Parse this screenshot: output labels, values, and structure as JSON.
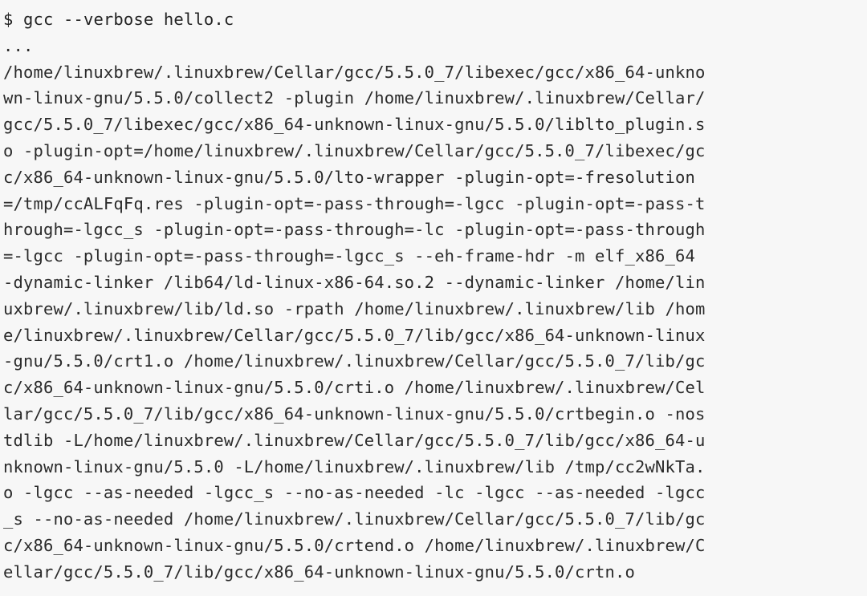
{
  "terminal": {
    "prompt": "$",
    "command": "gcc --verbose hello.c",
    "ellipsis": "...",
    "output": [
      "/home/linuxbrew/.linuxbrew/Cellar/gcc/5.5.0_7/libexec/gcc/x86_64-unkno",
      "wn-linux-gnu/5.5.0/collect2 -plugin /home/linuxbrew/.linuxbrew/Cellar/",
      "gcc/5.5.0_7/libexec/gcc/x86_64-unknown-linux-gnu/5.5.0/liblto_plugin.s",
      "o -plugin-opt=/home/linuxbrew/.linuxbrew/Cellar/gcc/5.5.0_7/libexec/gc",
      "c/x86_64-unknown-linux-gnu/5.5.0/lto-wrapper -plugin-opt=-fresolution",
      "=/tmp/ccALFqFq.res -plugin-opt=-pass-through=-lgcc -plugin-opt=-pass-t",
      "hrough=-lgcc_s -plugin-opt=-pass-through=-lc -plugin-opt=-pass-through",
      "=-lgcc -plugin-opt=-pass-through=-lgcc_s --eh-frame-hdr -m elf_x86_64",
      "-dynamic-linker /lib64/ld-linux-x86-64.so.2 --dynamic-linker /home/lin",
      "uxbrew/.linuxbrew/lib/ld.so -rpath /home/linuxbrew/.linuxbrew/lib /hom",
      "e/linuxbrew/.linuxbrew/Cellar/gcc/5.5.0_7/lib/gcc/x86_64-unknown-linux",
      "-gnu/5.5.0/crt1.o /home/linuxbrew/.linuxbrew/Cellar/gcc/5.5.0_7/lib/gc",
      "c/x86_64-unknown-linux-gnu/5.5.0/crti.o /home/linuxbrew/.linuxbrew/Cel",
      "lar/gcc/5.5.0_7/lib/gcc/x86_64-unknown-linux-gnu/5.5.0/crtbegin.o -nos",
      "tdlib -L/home/linuxbrew/.linuxbrew/Cellar/gcc/5.5.0_7/lib/gcc/x86_64-u",
      "nknown-linux-gnu/5.5.0 -L/home/linuxbrew/.linuxbrew/lib /tmp/cc2wNkTa.",
      "o -lgcc --as-needed -lgcc_s --no-as-needed -lc -lgcc --as-needed -lgcc",
      "_s --no-as-needed /home/linuxbrew/.linuxbrew/Cellar/gcc/5.5.0_7/lib/gc",
      "c/x86_64-unknown-linux-gnu/5.5.0/crtend.o /home/linuxbrew/.linuxbrew/C",
      "ellar/gcc/5.5.0_7/lib/gcc/x86_64-unknown-linux-gnu/5.5.0/crtn.o"
    ]
  }
}
